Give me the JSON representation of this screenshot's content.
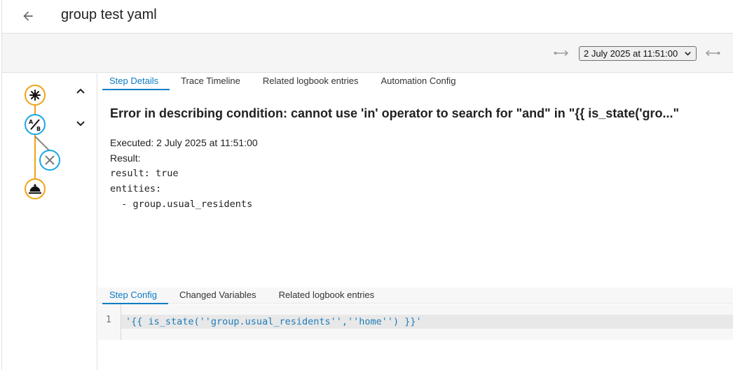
{
  "header": {
    "title": "group test yaml"
  },
  "toolbar": {
    "selected_run": "2 July 2025 at 11:51:00"
  },
  "tabs": [
    {
      "label": "Step Details",
      "active": true
    },
    {
      "label": "Trace Timeline",
      "active": false
    },
    {
      "label": "Related logbook entries",
      "active": false
    },
    {
      "label": "Automation Config",
      "active": false
    }
  ],
  "details": {
    "error": "Error in describing condition: cannot use 'in' operator to search for \"and\" in \"{{ is_state('gro...\"",
    "executed": "Executed: 2 July 2025 at 11:51:00",
    "result_label": "Result:",
    "result_lines": [
      "result: true",
      "entities:",
      "  - group.usual_residents"
    ]
  },
  "config_tabs": [
    {
      "label": "Step Config",
      "active": true
    },
    {
      "label": "Changed Variables",
      "active": false
    },
    {
      "label": "Related logbook entries",
      "active": false
    }
  ],
  "editor": {
    "line_number": "1",
    "code": "'{{ is_state(''group.usual_residents'',''home'') }}'"
  },
  "colors": {
    "accent": "#0c7bc4",
    "node_orange": "#f1a316",
    "node_blue": "#18a6e8"
  }
}
